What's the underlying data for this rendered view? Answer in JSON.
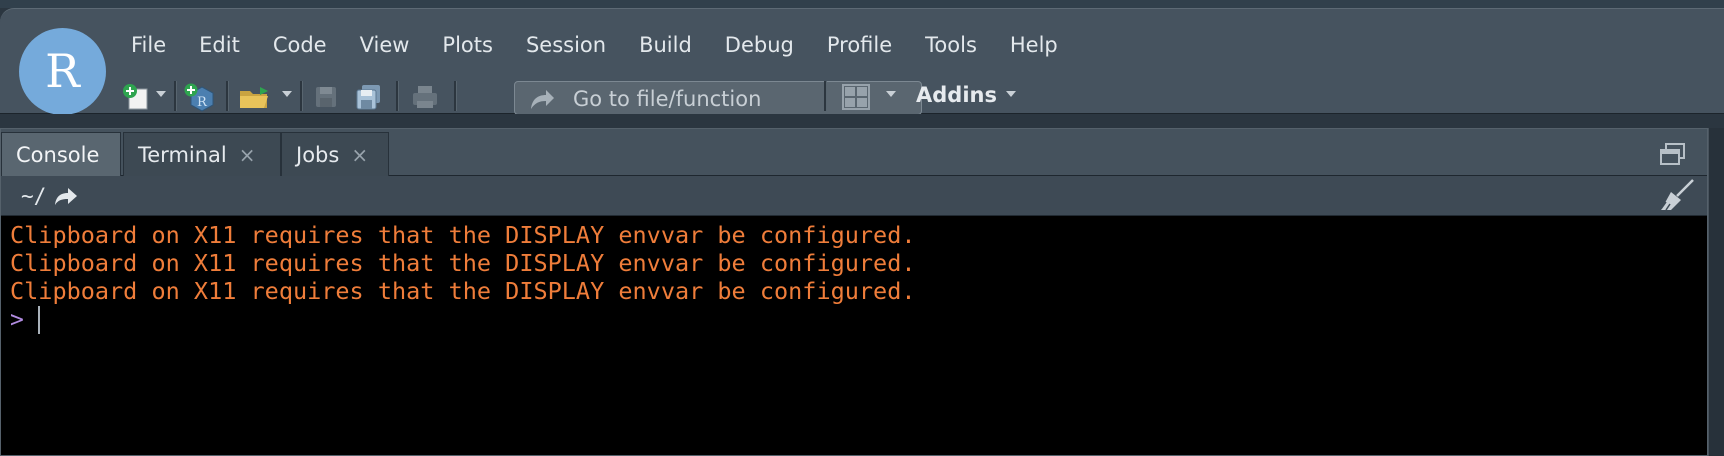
{
  "app": {
    "logo_letter": "R"
  },
  "menu": [
    "File",
    "Edit",
    "Code",
    "View",
    "Plots",
    "Session",
    "Build",
    "Debug",
    "Profile",
    "Tools",
    "Help"
  ],
  "toolbar": {
    "goto_placeholder": "Go to file/function",
    "addins_label": "Addins"
  },
  "tabs": [
    {
      "label": "Console",
      "active": true,
      "closable": false
    },
    {
      "label": "Terminal",
      "active": false,
      "closable": true
    },
    {
      "label": "Jobs",
      "active": false,
      "closable": true
    }
  ],
  "tab_close_glyph": "×",
  "console": {
    "path": "~/",
    "output_lines": [
      "Clipboard on X11 requires that the DISPLAY envvar be configured.",
      "Clipboard on X11 requires that the DISPLAY envvar be configured.",
      "Clipboard on X11 requires that the DISPLAY envvar be configured."
    ],
    "prompt": ">"
  },
  "colors": {
    "logo": "#75aadb",
    "error_text": "#ef7d3a",
    "prompt": "#b18be0",
    "toolbar_bg": "#46535f"
  },
  "icons": [
    "new-file-icon",
    "new-project-icon",
    "open-folder-icon",
    "save-icon",
    "save-all-icon",
    "print-icon",
    "goto-arrow-icon",
    "pane-layout-icon",
    "restore-pane-icon",
    "redirect-arrow-icon",
    "broom-icon"
  ]
}
